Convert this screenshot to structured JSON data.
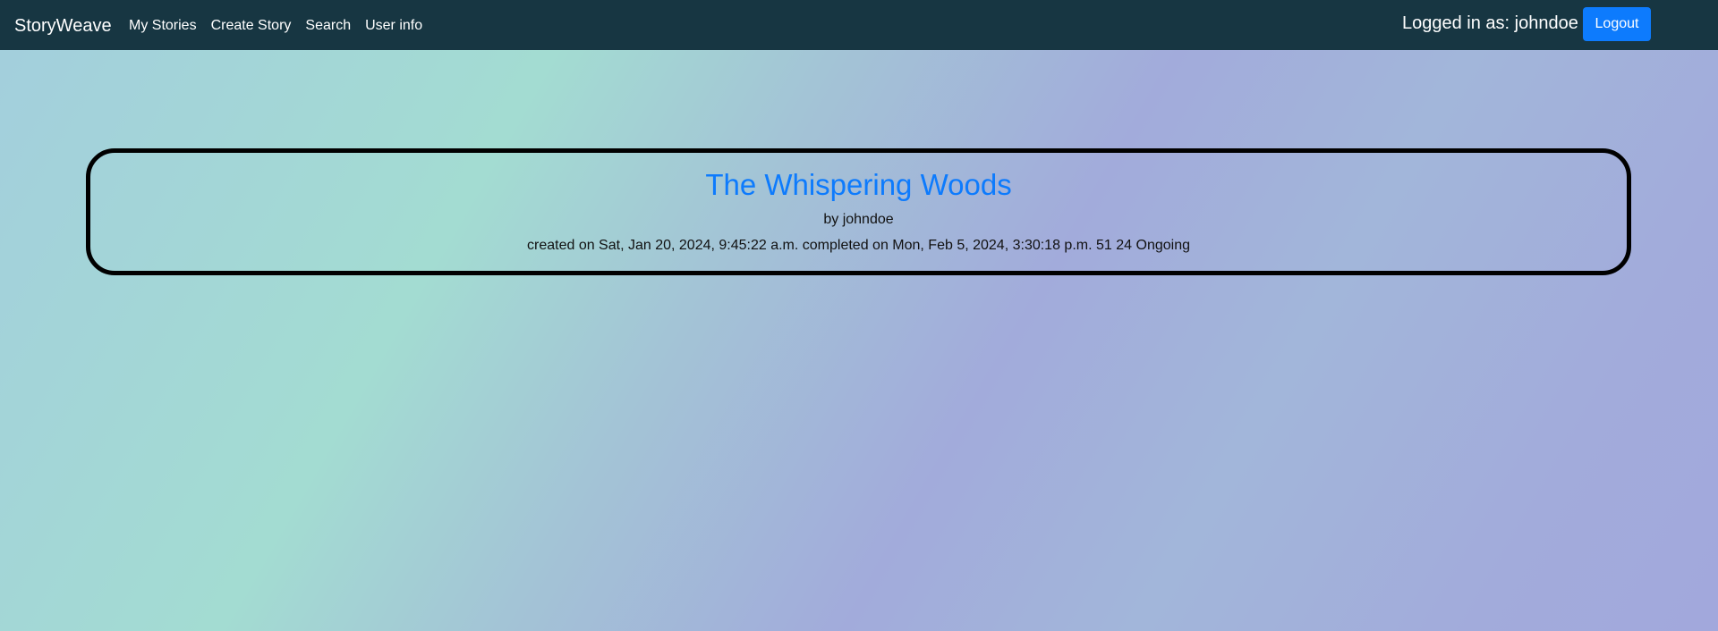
{
  "navbar": {
    "brand": "StoryWeave",
    "links": [
      "My Stories",
      "Create Story",
      "Search",
      "User info"
    ],
    "logged_in_text": "Logged in as: johndoe",
    "logout_label": "Logout"
  },
  "story": {
    "title": "The Whispering Woods",
    "author_line": "by johndoe",
    "created": "created on Sat, Jan 20, 2024, 9:45:22 a.m.",
    "completed": "completed on Mon, Feb 5, 2024, 3:30:18 p.m.",
    "count_a": "51",
    "count_b": "24",
    "status": "Ongoing"
  },
  "colors": {
    "navbar_bg": "#173642",
    "accent": "#0d7bfd",
    "card_border": "#000000"
  }
}
